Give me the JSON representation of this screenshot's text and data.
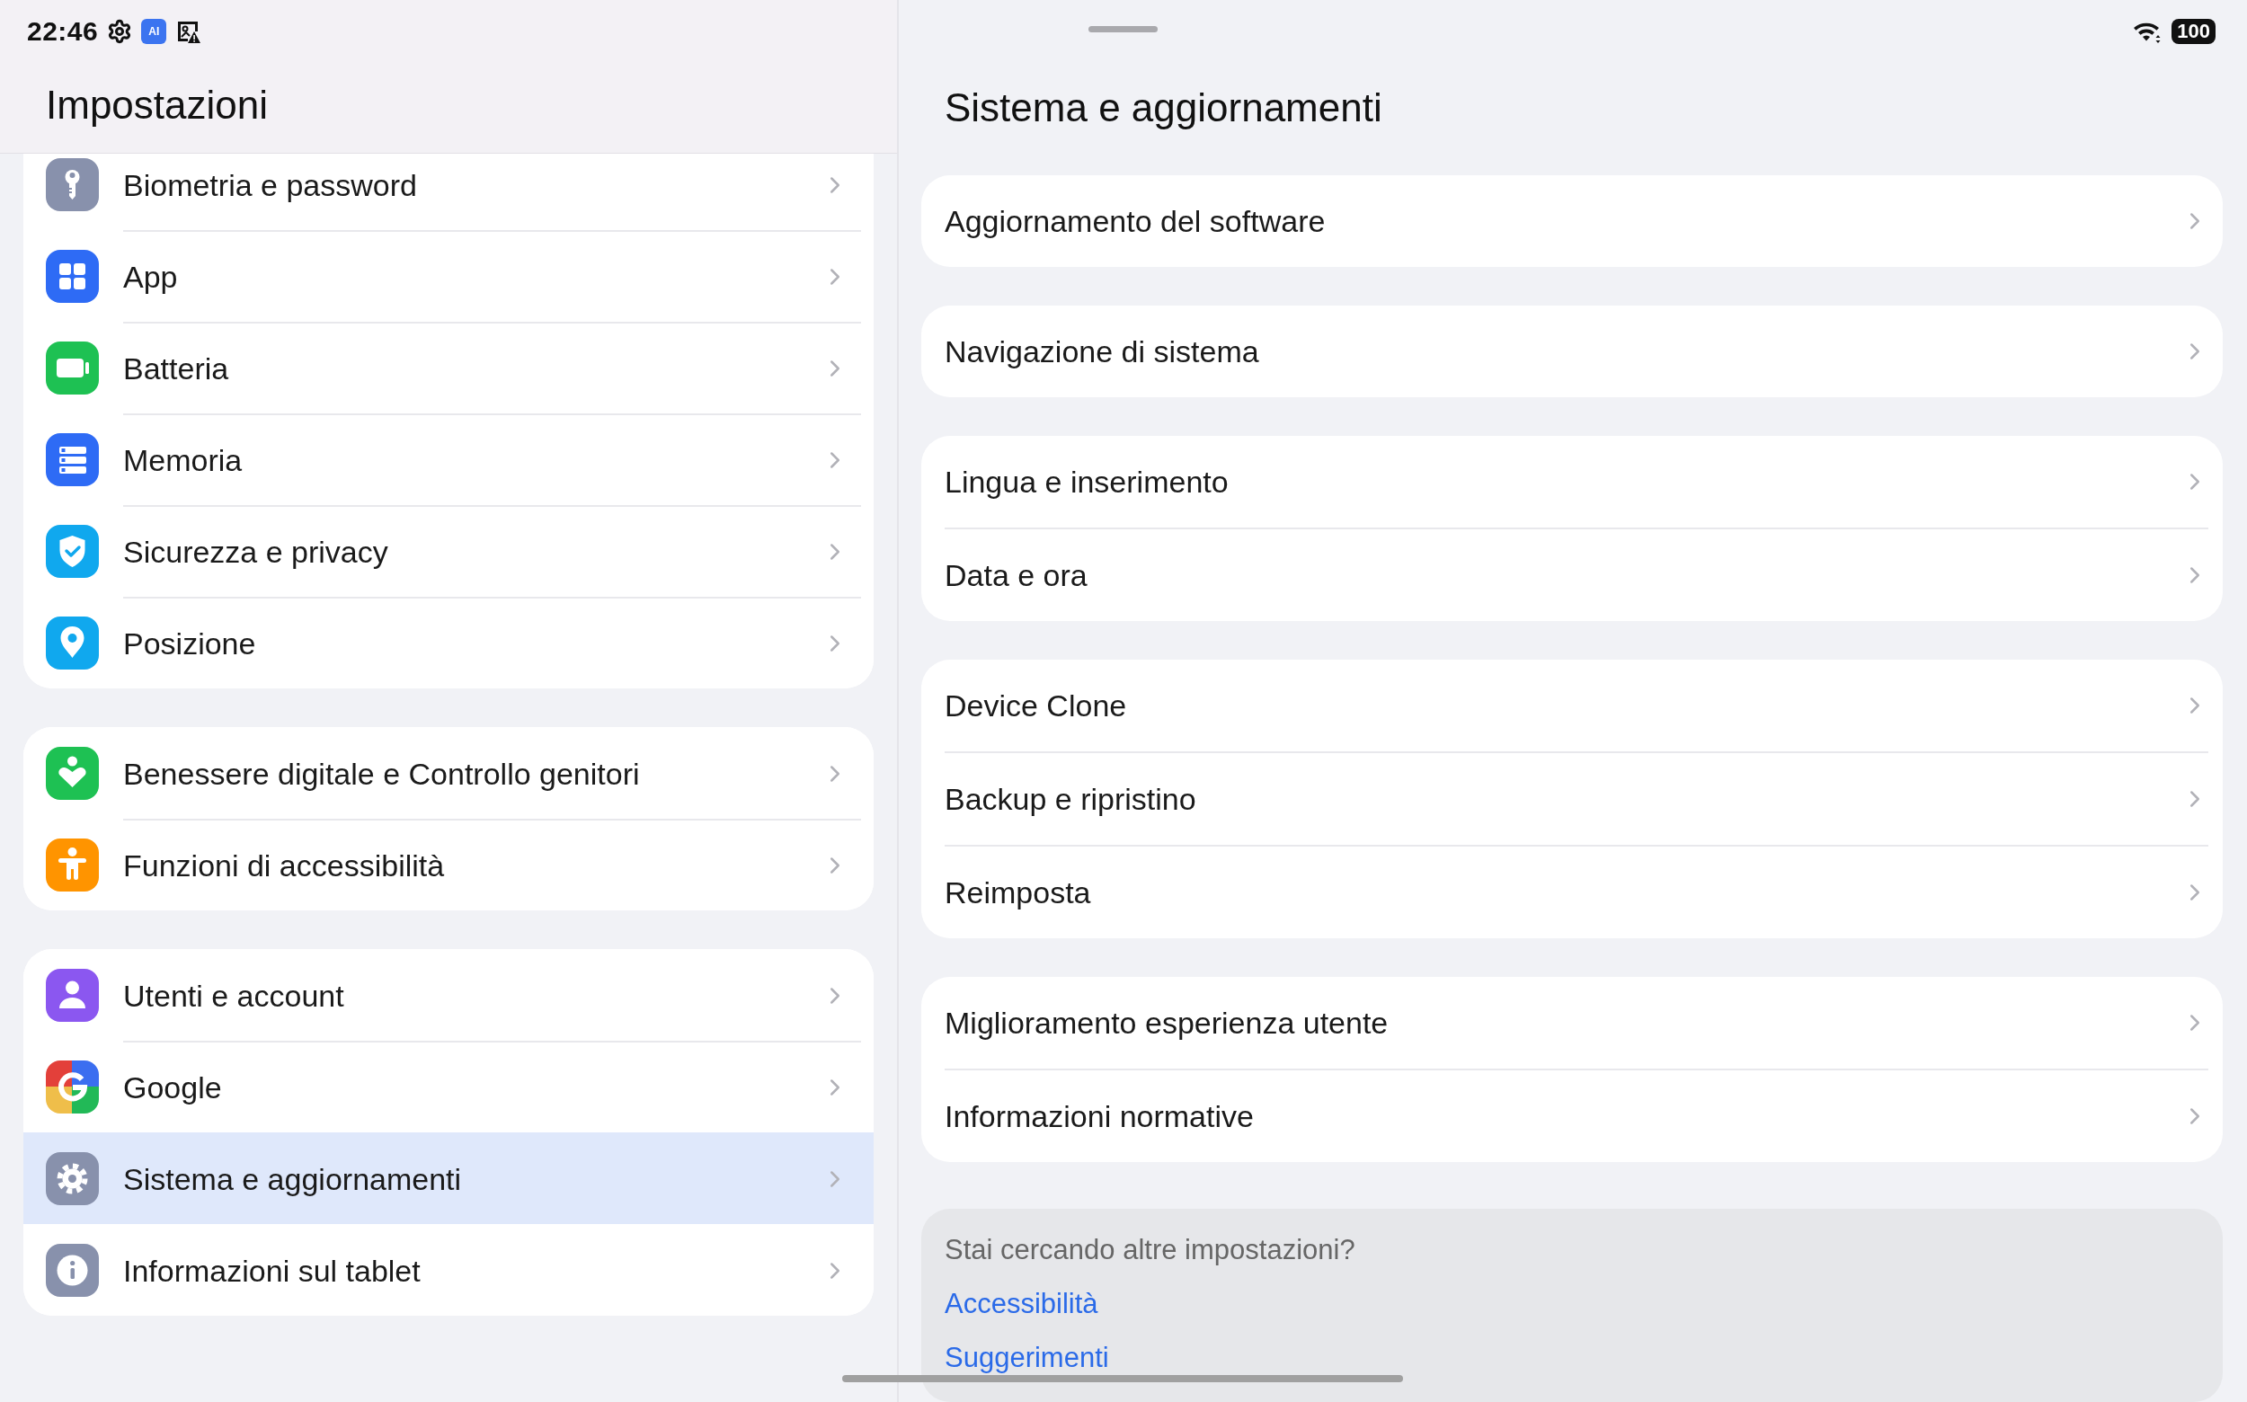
{
  "status_bar": {
    "time": "22:46",
    "badge": "AI",
    "battery": "100"
  },
  "sidebar": {
    "title": "Impostazioni",
    "groups": [
      [
        {
          "kind": "key",
          "label": "Biometria e password",
          "selected": false
        },
        {
          "kind": "apps",
          "label": "App",
          "selected": false
        },
        {
          "kind": "battery",
          "label": "Batteria",
          "selected": false
        },
        {
          "kind": "storage",
          "label": "Memoria",
          "selected": false
        },
        {
          "kind": "shield",
          "label": "Sicurezza e privacy",
          "selected": false
        },
        {
          "kind": "location",
          "label": "Posizione",
          "selected": false
        }
      ],
      [
        {
          "kind": "wellbeing",
          "label": "Benessere digitale e Controllo genitori",
          "selected": false
        },
        {
          "kind": "accessibility",
          "label": "Funzioni di accessibilità",
          "selected": false
        }
      ],
      [
        {
          "kind": "user",
          "label": "Utenti e account",
          "selected": false
        },
        {
          "kind": "google",
          "label": "Google",
          "selected": false
        },
        {
          "kind": "gear",
          "label": "Sistema e aggiornamenti",
          "selected": true
        },
        {
          "kind": "info",
          "label": "Informazioni sul tablet",
          "selected": false
        }
      ]
    ]
  },
  "detail": {
    "title": "Sistema e aggiornamenti",
    "groups": [
      [
        "Aggiornamento del software"
      ],
      [
        "Navigazione di sistema"
      ],
      [
        "Lingua e inserimento",
        "Data e ora"
      ],
      [
        "Device Clone",
        "Backup e ripristino",
        "Reimposta"
      ],
      [
        "Miglioramento esperienza utente",
        "Informazioni normative"
      ]
    ],
    "suggestions": {
      "prompt": "Stai cercando altre impostazioni?",
      "links": [
        "Accessibilità",
        "Suggerimenti"
      ]
    }
  }
}
